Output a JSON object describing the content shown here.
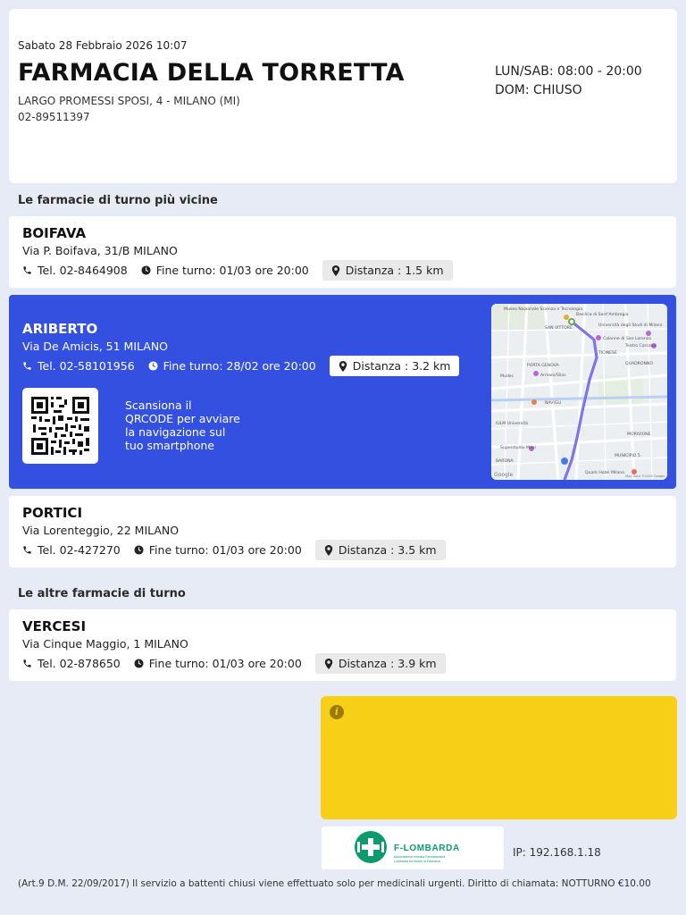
{
  "header": {
    "datetime": "Sabato 28 Febbraio 2026 10:07",
    "pharmacy_name": "FARMACIA DELLA TORRETTA",
    "address": "LARGO PROMESSI SPOSI, 4 - MILANO (MI)",
    "phone": "02-89511397",
    "hours_weekday": "LUN/SAB: 08:00 - 20:00",
    "hours_sunday": "DOM: CHIUSO"
  },
  "nearest_title": "Le farmacie di turno più vicine",
  "others_title": "Le altre farmacie di turno",
  "pharmacies": [
    {
      "name": "BOIFAVA",
      "address": "Via P. Boifava, 31/B MILANO",
      "phone": "Tel. 02-8464908",
      "shift_end": "Fine turno: 01/03 ore 20:00",
      "distance": "Distanza : 1.5 km"
    },
    {
      "name": "ARIBERTO",
      "address": "Via De Amicis, 51 MILANO",
      "phone": "Tel. 02-58101956",
      "shift_end": "Fine turno: 28/02 ore 20:00",
      "distance": "Distanza : 3.2 km"
    },
    {
      "name": "PORTICI",
      "address": "Via Lorenteggio, 22 MILANO",
      "phone": "Tel. 02-427270",
      "shift_end": "Fine turno: 01/03 ore 20:00",
      "distance": "Distanza : 3.5 km"
    },
    {
      "name": "VERCESI",
      "address": "Via Cinque Maggio, 1 MILANO",
      "phone": "Tel. 02-878650",
      "shift_end": "Fine turno: 01/03 ore 20:00",
      "distance": "Distanza : 3.9 km"
    }
  ],
  "qr": {
    "line1": "Scansiona il",
    "line2": "QRCODE per avviare",
    "line3": "la navigazione sul",
    "line4": "tuo smartphone"
  },
  "map_labels": {
    "museo": "Museo Nazionale Scienza e Tecnologia",
    "basilica": "Basilica di Sant'Ambrogio",
    "san_vittore": "SAN VITTORE",
    "universita": "Università degli Studi di Milano",
    "colonne": "Colonne di San Lorenzo",
    "ticinese": "TICINESE",
    "teatro": "Teatro Carcano",
    "porta_genova": "PORTA GENOVA",
    "quadronno": "QUADRONNO",
    "mudec": "Mudec",
    "armani": "Armani/Silos",
    "naviglio": "NAVIGLI",
    "iulm": "IULM Università",
    "barona": "BARONA",
    "superstudio": "Superstudio Maxi",
    "morivione": "MORIVIONE",
    "municipio": "MUNICIPIO 5",
    "quark": "Quark Hotel Milano",
    "google": "Google",
    "map_data": "Map data ©2026 Google"
  },
  "logo": {
    "brand": "F-LOMBARDA",
    "line1": "Associazione chimica Farmaceutica",
    "line2": "Lombarda tra titolari di Farmacia"
  },
  "info_icon": "info-icon",
  "ip": "IP: 192.168.1.18",
  "footer_note": "(Art.9 D.M. 22/09/2017) Il servizio a battenti chiusi viene effettuato solo per medicinali urgenti. Diritto di chiamata: NOTTURNO €10.00",
  "colors": {
    "background": "#e6ebf5",
    "highlight": "#3450e0",
    "info": "#f7cf16",
    "logo_green": "#0d9b6e"
  }
}
